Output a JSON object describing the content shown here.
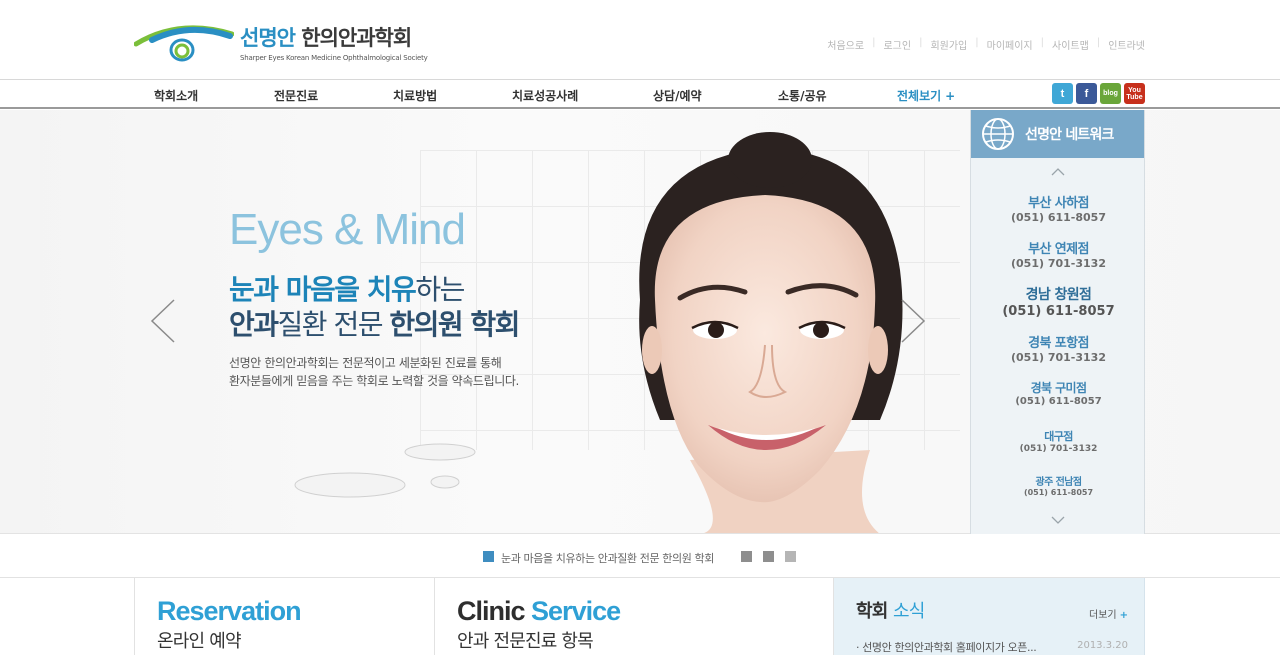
{
  "header": {
    "logo_title_a": "선명안",
    "logo_title_b": "한의안과학회",
    "logo_sub": "Sharper Eyes Korean Medicine Ophthalmological Society",
    "util_links": [
      "처음으로",
      "로그인",
      "회원가입",
      "마이페이지",
      "사이트맵",
      "인트라넷"
    ]
  },
  "gnb": {
    "items": [
      "학회소개",
      "전문진료",
      "치료방법",
      "치료성공사례",
      "상담/예약",
      "소통/공유"
    ],
    "all_label": "전체보기",
    "all_plus": "+",
    "sns": [
      "t",
      "f",
      "blog",
      "You Tube"
    ]
  },
  "hero": {
    "title_en": "Eyes & Mind",
    "h1_hl": "눈과 마음을 치유",
    "h1_rest": "하는",
    "h2_a": "안과",
    "h2_b": "질환 전문 ",
    "h2_c": "한의원 학회",
    "desc_line1": "선명안 한의안과학회는 전문적이고 세분화된 진료를 통해",
    "desc_line2": "환자분들에게 믿음을 주는 학회로 노력할 것을 약속드립니다."
  },
  "network": {
    "title": "선명안 네트워크",
    "branches": [
      {
        "name": "부산 사하점",
        "phone": "(051) 611-8057"
      },
      {
        "name": "부산 연제점",
        "phone": "(051) 701-3132"
      },
      {
        "name": "경남 창원점",
        "phone": "(051) 611-8057"
      },
      {
        "name": "경북 포항점",
        "phone": "(051) 701-3132"
      },
      {
        "name": "경북 구미점",
        "phone": "(051) 611-8057"
      },
      {
        "name": "대구점",
        "phone": "(051) 701-3132"
      },
      {
        "name": "광주 전남점",
        "phone": "(051) 611-8057"
      }
    ]
  },
  "indicator": {
    "caption": "눈과 마음을 치유하는 안과질환 전문 한의원 학회"
  },
  "boxes": {
    "reservation_en": "Reservation",
    "reservation_ko": "온라인 예약",
    "clinic_en_a": "Clinic",
    "clinic_en_b": "Service",
    "clinic_ko": "안과 전문진료 항목",
    "news_title_a": "학회",
    "news_title_b": "소식",
    "news_more": "더보기",
    "news_more_plus": "+",
    "news_item": "· 선명안 한의안과학회 홈페이지가 오픈...",
    "news_date": "2013.3.20"
  },
  "colors": {
    "accent": "#2fa0d5",
    "brand_dark": "#2d4f6e",
    "network_head": "#79a8c9"
  }
}
